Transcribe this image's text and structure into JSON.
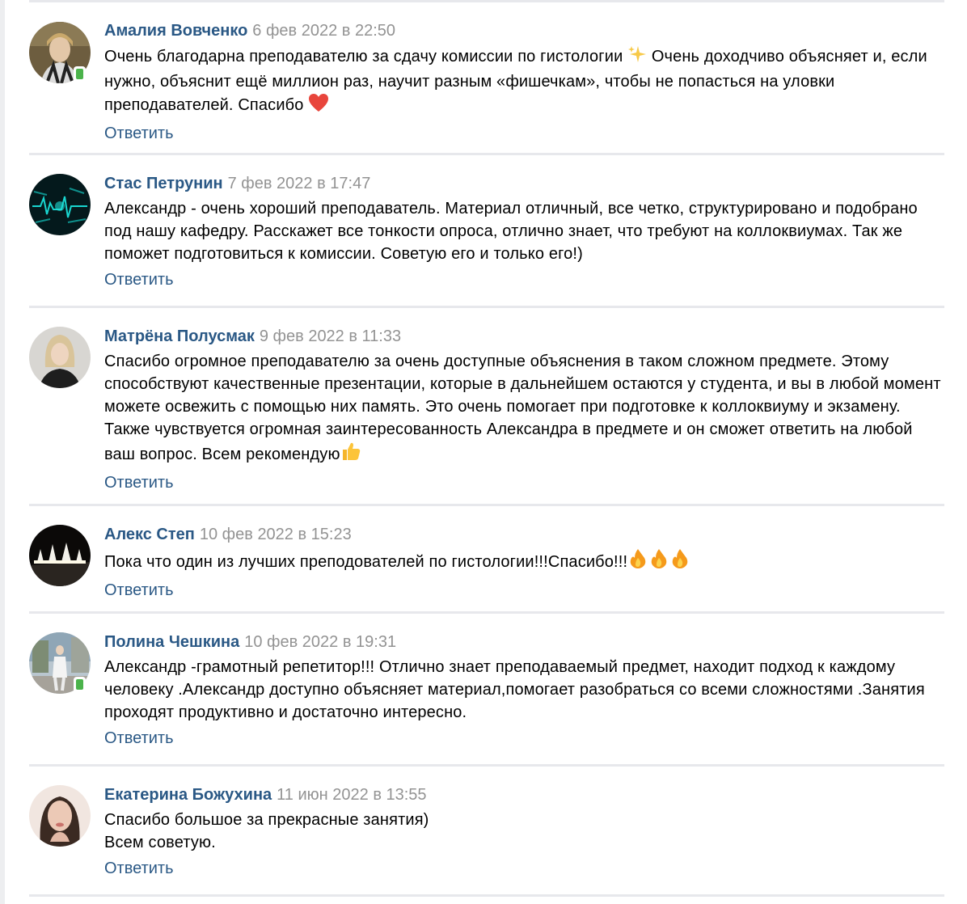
{
  "comments": [
    {
      "author": "Амалия Вовченко",
      "date": "6 фев 2022 в 22:50",
      "text_a": "Очень благодарна преподавателю за сдачу комиссии по гистологии ",
      "text_b": " Очень доходчиво объясняет и, если нужно, объяснит ещё миллион раз, научит разным «фишечкам», чтобы не попасться на уловки преподавателей. Спасибо ",
      "reply": "Ответить"
    },
    {
      "author": "Стас Петрунин",
      "date": "7 фев 2022 в 17:47",
      "text_a": "Александр - очень хороший преподаватель. Материал отличный, все четко, структурировано и подобрано под нашу кафедру. Расскажет все тонкости опроса, отлично знает, что требуют на коллоквиумах. Так же поможет подготовиться к комиссии. Советую его и только его!)",
      "reply": "Ответить"
    },
    {
      "author": "Матрёна Полусмак",
      "date": "9 фев 2022 в 11:33",
      "text_a": "Спасибо огромное преподавателю за очень доступные объяснения в таком сложном предмете. Этому способствуют качественные презентации, которые в дальнейшем остаются у студента, и вы в любой момент можете освежить с помощью них память. Это очень помогает при подготовке к коллоквиуму и экзамену. Также чувствуется огромная заинтересованность Александра в предмете и он сможет ответить на любой ваш вопрос. Всем рекомендую",
      "reply": "Ответить"
    },
    {
      "author": "Алекс Степ",
      "date": "10 фев 2022 в 15:23",
      "text_a": "Пока что один из лучших преподователей по гистологии!!!Спасибо!!!",
      "reply": "Ответить"
    },
    {
      "author": "Полина Чешкина",
      "date": "10 фев 2022 в 19:31",
      "text_a": "Александр -грамотный репетитор!!! Отлично знает преподаваемый предмет, находит подход к каждому человеку .Александр доступно объясняет материал,помогает разобраться со всеми сложностями .Занятия проходят продуктивно и достаточно интересно.",
      "reply": "Ответить"
    },
    {
      "author": "Екатерина Божухина",
      "date": "11 июн 2022 в 13:55",
      "text_a": "Спасибо большое за прекрасные занятия)",
      "text_b": "Всем советую.",
      "reply": "Ответить"
    }
  ]
}
